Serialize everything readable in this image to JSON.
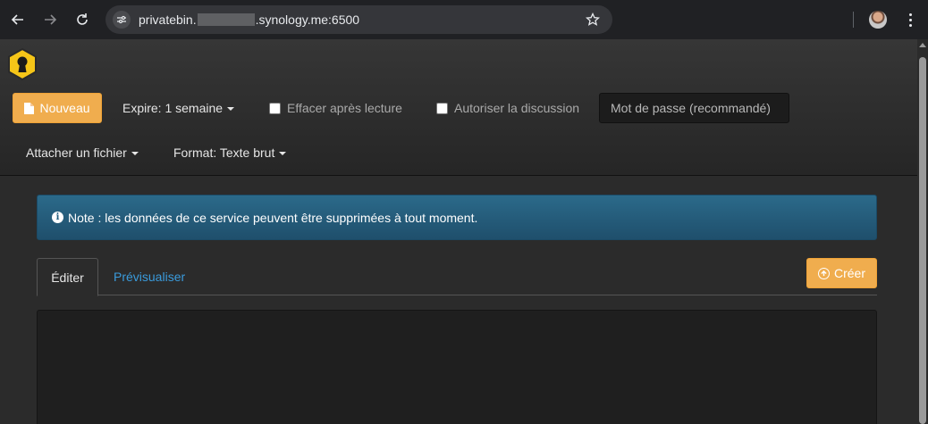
{
  "browser": {
    "url_prefix": "privatebin.",
    "url_suffix": ".synology.me:6500",
    "icons": [
      "back-arrow-icon",
      "forward-arrow-icon",
      "reload-icon",
      "site-info-icon",
      "star-icon",
      "avatar",
      "kebab-menu-icon"
    ]
  },
  "navbar": {
    "new_button": "Nouveau",
    "expire": "Expire: 1 semaine",
    "burn_after_reading": "Effacer après lecture",
    "open_discussion": "Autoriser la discussion",
    "password_placeholder": "Mot de passe (recommandé)",
    "attach_file": "Attacher un fichier",
    "format": "Format: Texte brut"
  },
  "alert": {
    "text": "Note : les données de ce service peuvent être supprimées à tout moment."
  },
  "tabs": {
    "edit": "Éditer",
    "preview": "Prévisualiser"
  },
  "actions": {
    "create": "Créer"
  },
  "colors": {
    "accent": "#f0ad4e",
    "link": "#3a9bdc",
    "alert_bg": "#235f80",
    "chrome_bg": "#202124"
  }
}
